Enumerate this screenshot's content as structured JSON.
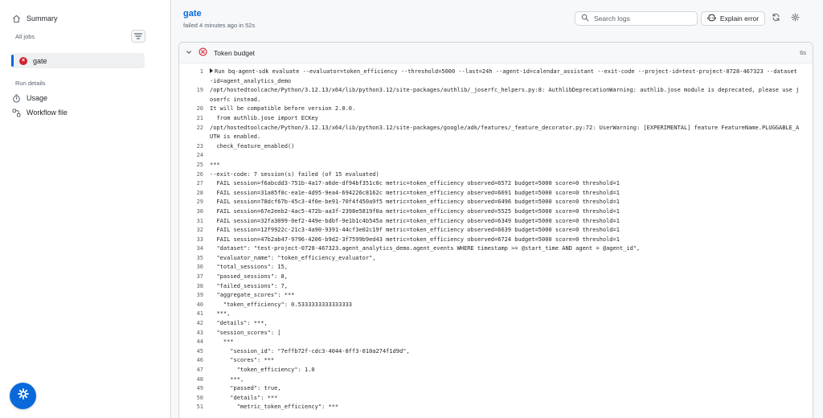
{
  "sidebar": {
    "summary_label": "Summary",
    "all_jobs_label": "All jobs",
    "job_label": "gate",
    "run_details_label": "Run details",
    "usage_label": "Usage",
    "workflow_file_label": "Workflow file"
  },
  "header": {
    "title": "gate",
    "subtitle": "failed 4 minutes ago in 52s",
    "search_placeholder": "Search logs",
    "explain_label": "Explain error"
  },
  "step": {
    "name": "Token budget",
    "duration": "6s"
  },
  "colors": {
    "accent": "#0969da",
    "failure": "#cf222e"
  },
  "log_lines": [
    {
      "n": "1",
      "t": "Run bq-agent-sdk evaluate --evaluator=token_efficiency --threshold=5000 --last=24h --agent-id=calendar_assistant --exit-code --project-id=test-project-0728-467323 --dataset-id=agent_analytics_demo"
    },
    {
      "n": "19",
      "t": "/opt/hostedtoolcache/Python/3.12.13/x64/lib/python3.12/site-packages/authlib/_joserfc_helpers.py:8: AuthlibDeprecationWarning: authlib.jose module is deprecated, please use joserfc instead."
    },
    {
      "n": "20",
      "t": "It will be compatible before version 2.0.0."
    },
    {
      "n": "21",
      "t": "  from authlib.jose import ECKey"
    },
    {
      "n": "22",
      "t": "/opt/hostedtoolcache/Python/3.12.13/x64/lib/python3.12/site-packages/google/adk/features/_feature_decorator.py:72: UserWarning: [EXPERIMENTAL] feature FeatureName.PLUGGABLE_AUTH is enabled."
    },
    {
      "n": "23",
      "t": "  check_feature_enabled()"
    },
    {
      "n": "24",
      "t": ""
    },
    {
      "n": "25",
      "t": "***"
    },
    {
      "n": "26",
      "t": "--exit-code: 7 session(s) failed (of 15 evaluated)"
    },
    {
      "n": "27",
      "t": "  FAIL session=f6abcdd3-751b-4a17-a6de-df94bf351c0c metric=token_efficiency observed=6572 budget=5000 score=0 threshold=1"
    },
    {
      "n": "28",
      "t": "  FAIL session=31a85f0c-ea1e-4d95-9ea4-694226c8162c metric=token_efficiency observed=6691 budget=5000 score=0 threshold=1"
    },
    {
      "n": "29",
      "t": "  FAIL session=78dcf67b-45c3-4f0e-be91-70f4f450a9f5 metric=token_efficiency observed=6496 budget=5000 score=0 threshold=1"
    },
    {
      "n": "30",
      "t": "  FAIL session=67e2eeb2-4ac5-472b-aa3f-2398e5819f0a metric=token_efficiency observed=5525 budget=5000 score=0 threshold=1"
    },
    {
      "n": "31",
      "t": "  FAIL session=32fa3099-0ef2-449e-bdbf-9e1b1c4b545a metric=token_efficiency observed=6349 budget=5000 score=0 threshold=1"
    },
    {
      "n": "32",
      "t": "  FAIL session=12f9922c-21c3-4a90-9391-44cf3e02c19f metric=token_efficiency observed=6639 budget=5000 score=0 threshold=1"
    },
    {
      "n": "33",
      "t": "  FAIL session=47b2ab47-9796-4206-b9d2-3f7599b9ed43 metric=token_efficiency observed=6724 budget=5000 score=0 threshold=1"
    },
    {
      "n": "34",
      "t": "  \"dataset\": \"test-project-0728-467323.agent_analytics_demo.agent_events WHERE timestamp >= @start_time AND agent = @agent_id\","
    },
    {
      "n": "35",
      "t": "  \"evaluator_name\": \"token_efficiency_evaluator\","
    },
    {
      "n": "36",
      "t": "  \"total_sessions\": 15,"
    },
    {
      "n": "37",
      "t": "  \"passed_sessions\": 8,"
    },
    {
      "n": "38",
      "t": "  \"failed_sessions\": 7,"
    },
    {
      "n": "39",
      "t": "  \"aggregate_scores\": ***"
    },
    {
      "n": "40",
      "t": "    \"token_efficiency\": 0.5333333333333333"
    },
    {
      "n": "41",
      "t": "  ***,"
    },
    {
      "n": "42",
      "t": "  \"details\": ***,"
    },
    {
      "n": "43",
      "t": "  \"session_scores\": ["
    },
    {
      "n": "44",
      "t": "    ***"
    },
    {
      "n": "45",
      "t": "      \"session_id\": \"7effb72f-cdc3-4044-8ff3-010a274f1d9d\","
    },
    {
      "n": "46",
      "t": "      \"scores\": ***"
    },
    {
      "n": "47",
      "t": "        \"token_efficiency\": 1.0"
    },
    {
      "n": "48",
      "t": "      ***,"
    },
    {
      "n": "49",
      "t": "      \"passed\": true,"
    },
    {
      "n": "50",
      "t": "      \"details\": ***"
    },
    {
      "n": "51",
      "t": "        \"metric_token_efficiency\": ***"
    }
  ]
}
